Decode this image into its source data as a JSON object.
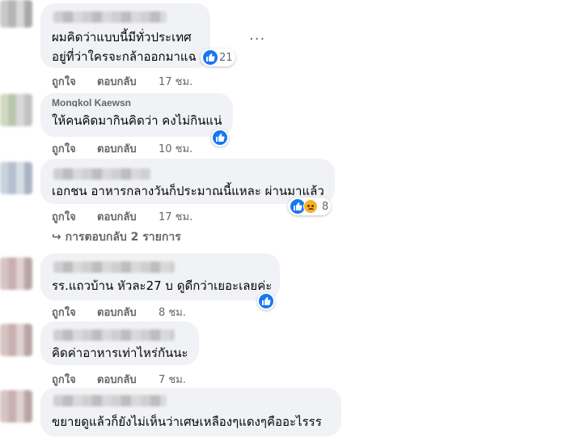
{
  "comments": [
    {
      "text_lines": [
        "ผมคิดว่าแบบนี้มีทั่วประเทศ",
        "อยู่ที่ว่าใครจะกล้าออกมาแฉ"
      ],
      "reaction_count": "21",
      "like_label": "ถูกใจ",
      "reply_label": "ตอบกลับ",
      "time": "17 ชม."
    },
    {
      "name": "Mongkol Kaewsn",
      "text_lines": [
        "ให้คนคิดมากินคิดว่า คงไม่กินแน่"
      ],
      "like_label": "ถูกใจ",
      "reply_label": "ตอบกลับ",
      "time": "10 ชม."
    },
    {
      "text_lines": [
        "เอกชน อาหารกลางวันก็ประมาณนี้แหละ ผ่านมาแล้ว"
      ],
      "reaction_count": "8",
      "like_label": "ถูกใจ",
      "reply_label": "ตอบกลับ",
      "time": "17 ชม."
    },
    {
      "text_lines": [
        "รร.แถวบ้าน หัวละ27 บ ดูดีกว่าเยอะเลยค่ะ"
      ],
      "like_label": "ถูกใจ",
      "reply_label": "ตอบกลับ",
      "time": "8 ชม."
    },
    {
      "text_lines": [
        "คิดค่าอาหารเท่าไหร่กันนะ"
      ],
      "like_label": "ถูกใจ",
      "reply_label": "ตอบกลับ",
      "time": "7 ชม."
    },
    {
      "text_lines": [
        "ขยายดูแล้วก็ยังไม่เห็นว่าเศษเหลืองๆแดงๆคืออะไรรร"
      ]
    }
  ],
  "view_replies": "↪ การตอบกลับ 2 รายการ",
  "more_menu": "···",
  "colors": {
    "bubble": "#f0f2f5",
    "like_blue": "#1877f2",
    "meta_gray": "#65676b"
  }
}
